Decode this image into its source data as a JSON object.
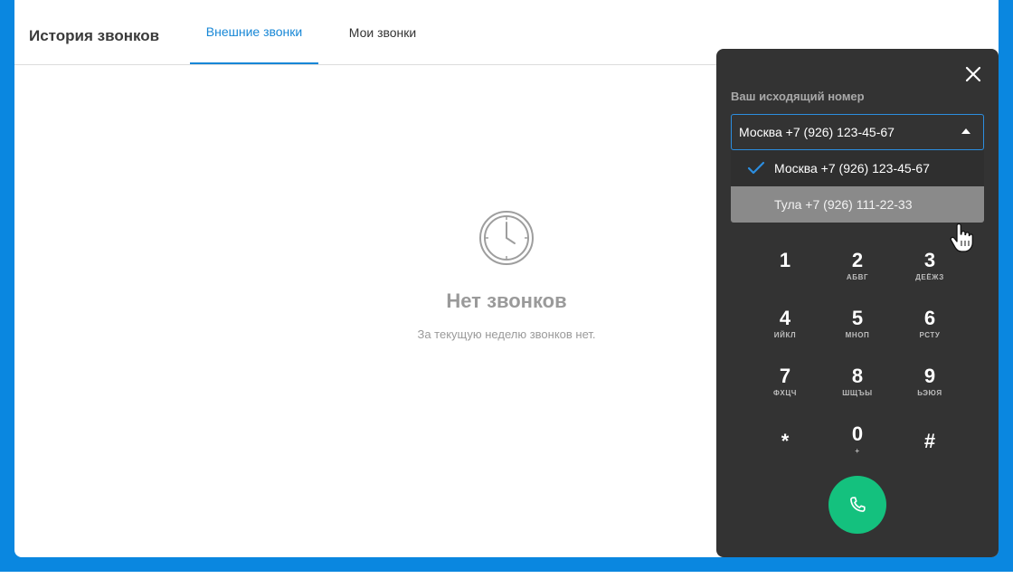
{
  "header": {
    "title": "История звонков",
    "tabs": [
      {
        "label": "Внешние звонки"
      },
      {
        "label": "Мои звонки"
      }
    ]
  },
  "empty_state": {
    "icon": "clock-icon",
    "title": "Нет звонков",
    "subtitle": "За текущую неделю звонков нет."
  },
  "dialer": {
    "outgoing_label": "Ваш исходящий номер",
    "selected": "Москва +7 (926) 123-45-67",
    "options": [
      {
        "label": "Москва +7 (926) 123-45-67"
      },
      {
        "label": "Тула +7 (926) 111-22-33"
      }
    ],
    "keys": [
      {
        "digit": "1",
        "letters": ""
      },
      {
        "digit": "2",
        "letters": "АБВГ"
      },
      {
        "digit": "3",
        "letters": "ДЕЁЖЗ"
      },
      {
        "digit": "4",
        "letters": "ИЙКЛ"
      },
      {
        "digit": "5",
        "letters": "МНОП"
      },
      {
        "digit": "6",
        "letters": "РСТУ"
      },
      {
        "digit": "7",
        "letters": "ФХЦЧ"
      },
      {
        "digit": "8",
        "letters": "ШЩЪЫ"
      },
      {
        "digit": "9",
        "letters": "ЬЭЮЯ"
      },
      {
        "digit": "*",
        "letters": ""
      },
      {
        "digit": "0",
        "letters": "+"
      },
      {
        "digit": "#",
        "letters": ""
      }
    ]
  },
  "colors": {
    "accent": "#1787d6",
    "background_blue": "#0a87e0",
    "dialer_bg": "#333333",
    "call_green": "#14c17e"
  }
}
